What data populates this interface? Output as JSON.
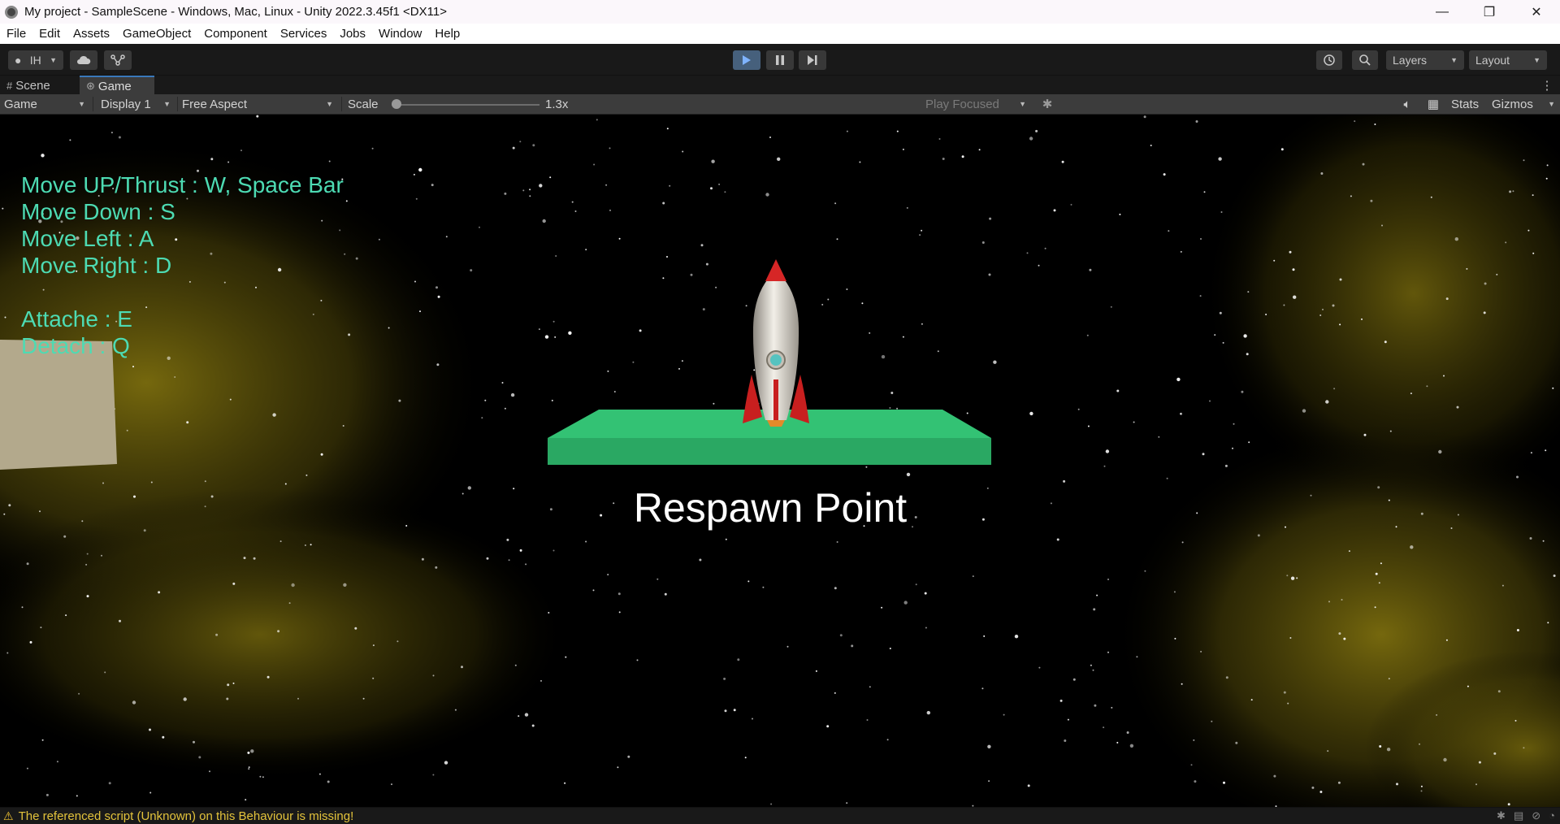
{
  "window": {
    "title": "My project - SampleScene - Windows, Mac, Linux - Unity 2022.3.45f1 <DX11>",
    "minimize": "—",
    "maximize": "❐",
    "close": "✕"
  },
  "menu": [
    "File",
    "Edit",
    "Assets",
    "GameObject",
    "Component",
    "Services",
    "Jobs",
    "Window",
    "Help"
  ],
  "toolbar": {
    "account_label": "IH",
    "layers_label": "Layers",
    "layout_label": "Layout",
    "play_state": "playing"
  },
  "tabs": [
    {
      "label": "Scene",
      "active": false
    },
    {
      "label": "Game",
      "active": true
    }
  ],
  "game_toolbar": {
    "view_mode": "Game",
    "display": "Display 1",
    "aspect": "Free Aspect",
    "scale_label": "Scale",
    "scale_value": "1.3x",
    "scale_fraction": 0.02,
    "play_mode": "Play Focused",
    "stats_label": "Stats",
    "gizmos_label": "Gizmos"
  },
  "game_view": {
    "hud_lines": [
      "Move UP/Thrust : W, Space Bar",
      "Move Down : S",
      "Move Left : A",
      "Move Right : D",
      "",
      "Attache : E",
      "Detach : Q"
    ],
    "respawn_label": "Respawn Point",
    "colors": {
      "hud_text": "#4ddbb3",
      "platform": "#2eb86a",
      "rocket_body": "#d8d4cc",
      "rocket_fins": "#c81f1f",
      "nebula": "#8a7a10"
    }
  },
  "status_bar": {
    "message": "The referenced script (Unknown) on this Behaviour is missing!",
    "level": "warning"
  }
}
